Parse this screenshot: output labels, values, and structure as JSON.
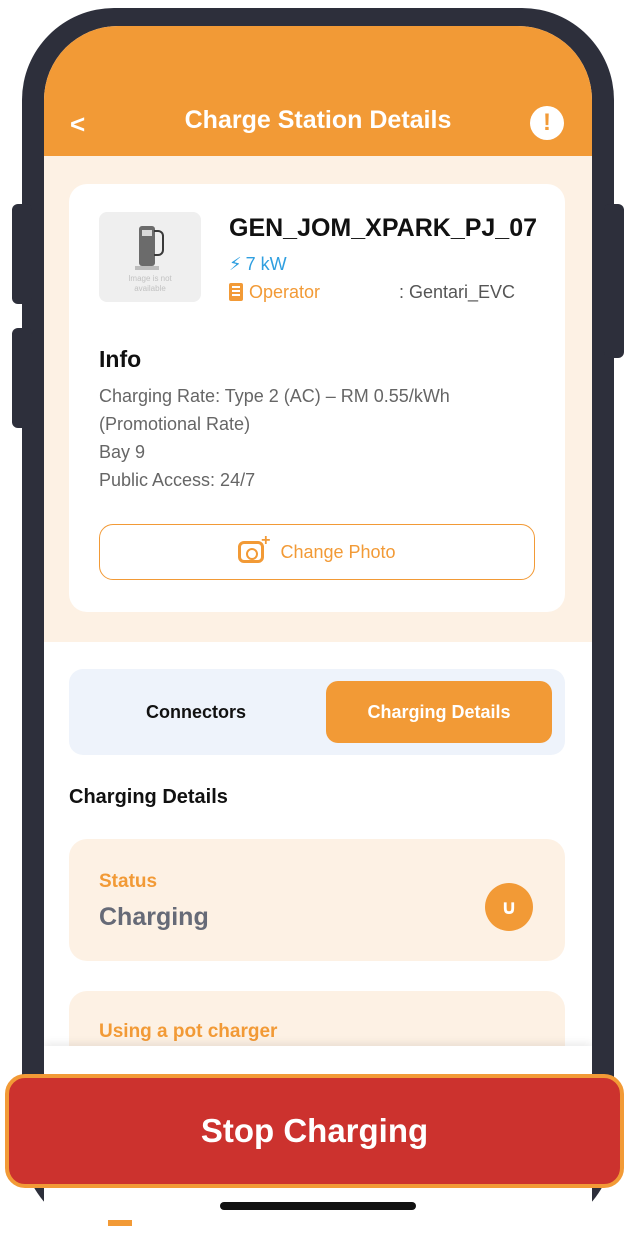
{
  "header": {
    "title": "Charge Station Details",
    "back_icon": "chevron-left-icon",
    "alert_icon": "exclamation-alert-icon",
    "back_glyph": "<",
    "alert_glyph": "!"
  },
  "station": {
    "image_caption_1": "Image is not",
    "image_caption_2": "available",
    "name": "GEN_JOM_XPARK_PJ_07",
    "power": "7 kW",
    "operator_label": "Operator",
    "operator_value": ": Gentari_EVC"
  },
  "info": {
    "title": "Info",
    "lines": [
      "Charging Rate: Type 2 (AC) – RM 0.55/kWh",
      "(Promotional Rate)",
      "Bay 9",
      "Public Access: 24/7"
    ]
  },
  "photo_button": {
    "label": "Change Photo"
  },
  "tabs": {
    "connectors": "Connectors",
    "charging_details": "Charging Details",
    "active": "charging_details"
  },
  "charging_details": {
    "section_title": "Charging Details",
    "status_key": "Status",
    "status_value": "Charging",
    "pot_charger_key": "Using a pot charger"
  },
  "actions": {
    "stop_label": "Stop Charging"
  },
  "colors": {
    "accent": "#f29a36",
    "danger": "#cc322e",
    "info_blue": "#2f9fe0",
    "cream": "#fdf1e4"
  }
}
